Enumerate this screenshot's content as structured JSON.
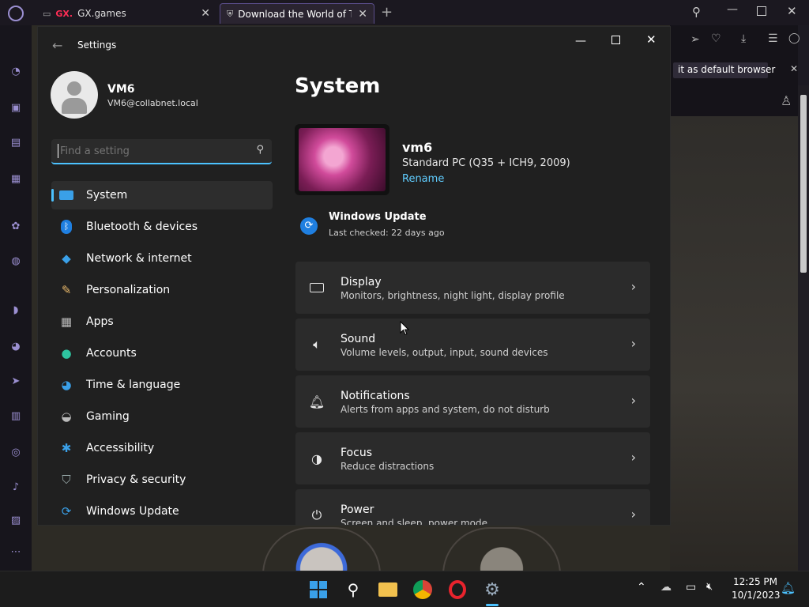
{
  "browser": {
    "tabs": [
      {
        "label": "GX.games",
        "brand": "GX."
      },
      {
        "label": "Download the World of Tan"
      }
    ],
    "default_banner": "it as default browser"
  },
  "settings": {
    "window_title": "Settings",
    "user": {
      "name": "VM6",
      "email": "VM6@collabnet.local"
    },
    "search_placeholder": "Find a setting",
    "nav": [
      {
        "label": "System",
        "icon": "monitor-icon"
      },
      {
        "label": "Bluetooth & devices",
        "icon": "bluetooth-icon"
      },
      {
        "label": "Network & internet",
        "icon": "wifi-icon"
      },
      {
        "label": "Personalization",
        "icon": "brush-icon"
      },
      {
        "label": "Apps",
        "icon": "apps-icon"
      },
      {
        "label": "Accounts",
        "icon": "person-icon"
      },
      {
        "label": "Time & language",
        "icon": "globe-icon"
      },
      {
        "label": "Gaming",
        "icon": "gamepad-icon"
      },
      {
        "label": "Accessibility",
        "icon": "accessibility-icon"
      },
      {
        "label": "Privacy & security",
        "icon": "shield-icon"
      },
      {
        "label": "Windows Update",
        "icon": "update-icon"
      }
    ],
    "page_title": "System",
    "device": {
      "name": "vm6",
      "model": "Standard PC (Q35 + ICH9, 2009)",
      "rename": "Rename"
    },
    "update": {
      "title": "Windows Update",
      "status": "Last checked: 22 days ago"
    },
    "cards": [
      {
        "title": "Display",
        "subtitle": "Monitors, brightness, night light, display profile",
        "icon": "display-icon"
      },
      {
        "title": "Sound",
        "subtitle": "Volume levels, output, input, sound devices",
        "icon": "speaker-icon"
      },
      {
        "title": "Notifications",
        "subtitle": "Alerts from apps and system, do not disturb",
        "icon": "bell-icon"
      },
      {
        "title": "Focus",
        "subtitle": "Reduce distractions",
        "icon": "focus-icon"
      },
      {
        "title": "Power",
        "subtitle": "Screen and sleep, power mode",
        "icon": "power-icon"
      }
    ]
  },
  "taskbar": {
    "time": "12:25 PM",
    "date": "10/1/2023"
  },
  "colors": {
    "accent": "#4cc2ff",
    "opera_purple": "#9b8fd1"
  }
}
